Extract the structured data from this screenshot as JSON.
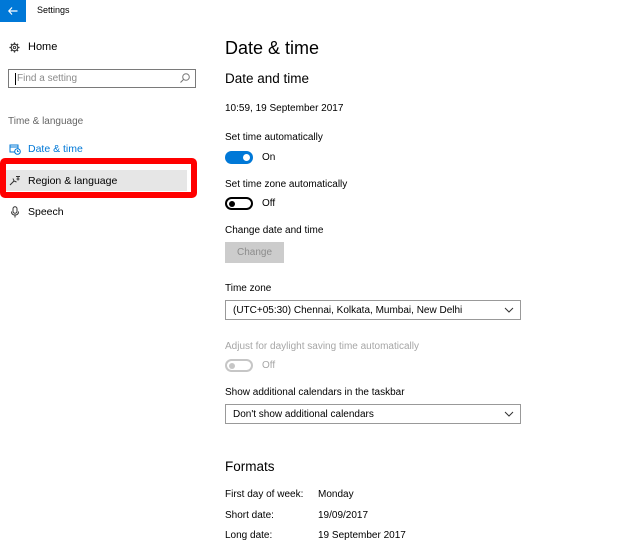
{
  "window": {
    "title": "Settings",
    "back_icon": "arrow-left-icon",
    "accent": "#0078d7"
  },
  "sidebar": {
    "home_label": "Home",
    "search_placeholder": "Find a setting",
    "section_label": "Time & language",
    "items": [
      {
        "label": "Date & time",
        "icon": "calendar-clock-icon",
        "active": true
      },
      {
        "label": "Region & language",
        "icon": "region-language-icon",
        "hover": true
      },
      {
        "label": "Speech",
        "icon": "microphone-icon"
      }
    ],
    "annotation_color": "#ff0000"
  },
  "main": {
    "page_title": "Date & time",
    "section_title": "Date and time",
    "current_datetime": "10:59, 19 September 2017",
    "set_time_auto": {
      "label": "Set time automatically",
      "state": "On",
      "on": true
    },
    "set_timezone_auto": {
      "label": "Set time zone automatically",
      "state": "Off",
      "on": false
    },
    "change_datetime": {
      "label": "Change date and time",
      "button": "Change"
    },
    "time_zone": {
      "label": "Time zone",
      "value": "(UTC+05:30) Chennai, Kolkata, Mumbai, New Delhi"
    },
    "daylight": {
      "label": "Adjust for daylight saving time automatically",
      "state": "Off",
      "disabled": true
    },
    "calendars": {
      "label": "Show additional calendars in the taskbar",
      "value": "Don't show additional calendars"
    },
    "formats": {
      "title": "Formats",
      "rows": [
        {
          "label": "First day of week:",
          "value": "Monday"
        },
        {
          "label": "Short date:",
          "value": "19/09/2017"
        },
        {
          "label": "Long date:",
          "value": "19 September 2017"
        }
      ]
    }
  }
}
